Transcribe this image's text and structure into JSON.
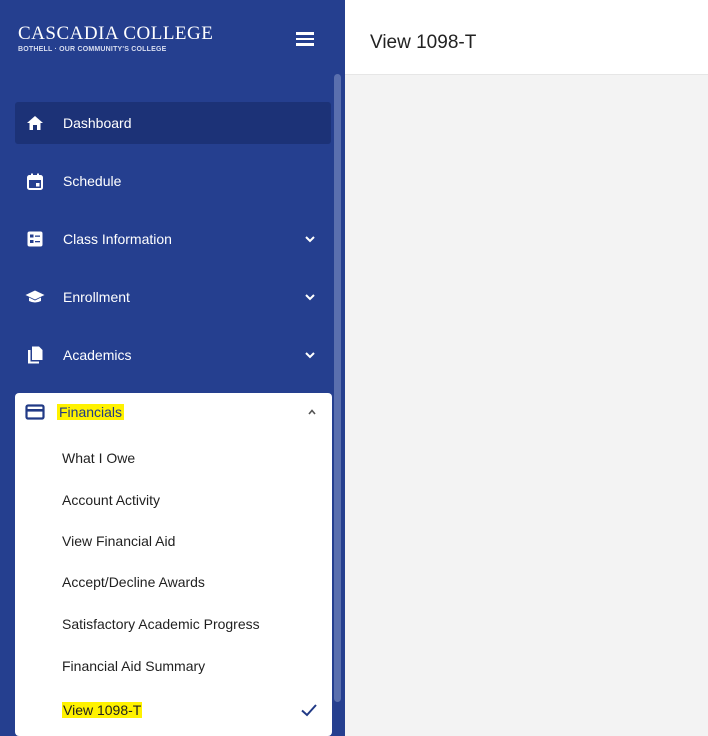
{
  "brand": {
    "name": "CASCADIA COLLEGE",
    "tagline": "BOTHELL · OUR COMMUNITY'S COLLEGE"
  },
  "header": {
    "title": "View 1098-T"
  },
  "sidebar": {
    "items": [
      {
        "label": "Dashboard",
        "icon": "home-icon",
        "active": true,
        "expandable": false
      },
      {
        "label": "Schedule",
        "icon": "calendar-icon",
        "expandable": false
      },
      {
        "label": "Class Information",
        "icon": "class-info-icon",
        "expandable": true
      },
      {
        "label": "Enrollment",
        "icon": "graduation-cap-icon",
        "expandable": true
      },
      {
        "label": "Academics",
        "icon": "documents-icon",
        "expandable": true
      }
    ],
    "financials": {
      "label": "Financials",
      "icon": "credit-card-icon",
      "expanded": true,
      "subitems": [
        {
          "label": "What I Owe"
        },
        {
          "label": "Account Activity"
        },
        {
          "label": "View Financial Aid"
        },
        {
          "label": "Accept/Decline Awards"
        },
        {
          "label": "Satisfactory Academic Progress"
        },
        {
          "label": "Financial Aid Summary"
        },
        {
          "label": "View 1098-T",
          "selected": true
        }
      ]
    }
  },
  "colors": {
    "sidebar": "#253f8f",
    "active_item": "#1c3277",
    "highlight": "#fff200"
  }
}
